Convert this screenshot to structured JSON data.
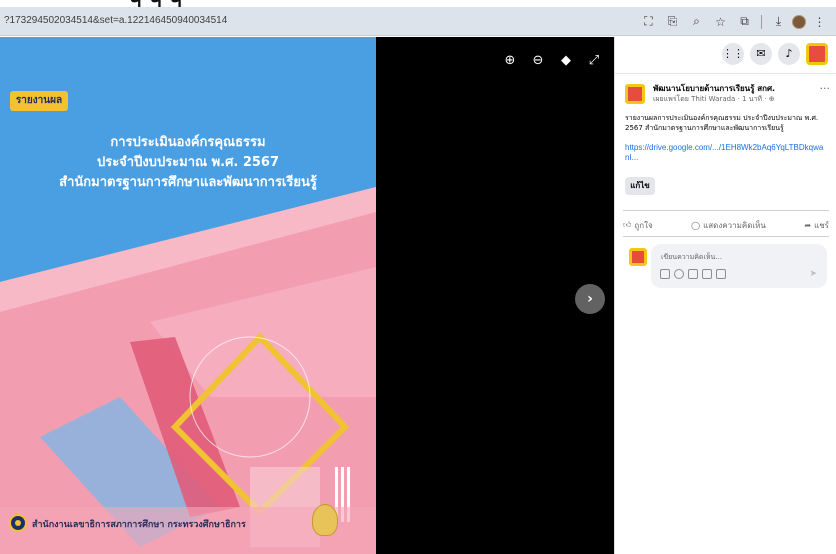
{
  "browser": {
    "url": "?173294502034514&set=a.122146450940034514",
    "icons": [
      "screenshot-icon",
      "translate-icon",
      "zoom-icon",
      "bookmark-star-icon",
      "extensions-icon",
      "download-icon",
      "profile-icon",
      "menu-icon"
    ]
  },
  "poster": {
    "tag": "รายงานผล",
    "title_line1": "การประเมินองค์กรคุณธรรม",
    "title_line2": "ประจำปีงบประมาณ พ.ศ. 2567",
    "title_line3": "สำนักมาตรฐานการศึกษาและพัฒนาการเรียนรู้",
    "footer": "สำนักงานเลขาธิการสภาการศึกษา กระทรวงศึกษาธิการ",
    "colors": {
      "pink": "#f39db0",
      "blue": "#4a9fe3",
      "gold": "#f1c232",
      "navy": "#2c2c5a"
    }
  },
  "viewer": {
    "tools": [
      "zoom-in-icon",
      "zoom-out-icon",
      "tag-icon",
      "fullscreen-icon"
    ],
    "next_glyph": "›"
  },
  "panel": {
    "top_icons": [
      "menu-grid-icon",
      "messenger-icon",
      "notifications-icon",
      "profile-avatar"
    ],
    "post": {
      "author": "พัฒนานโยบายด้านการเรียนรู้ สกศ.",
      "meta": "เผยแพร่โดย Thiti Warada · 1 นาที · ⊕",
      "more": "···",
      "body": "รายงานผลการประเมินองค์กรคุณธรรม ประจำปีงบประมาณ พ.ศ. 2567 สำนักมาตรฐานการศึกษาและพัฒนาการเรียนรู้",
      "link": "https://drive.google.com/.../1EH8Wk2bAq6YqLTBDkqwanI...",
      "edit_label": "แก้ไข"
    },
    "actions": {
      "like": "ถูกใจ",
      "comment": "แสดงความคิดเห็น",
      "share": "แชร์"
    },
    "comment": {
      "placeholder": "เขียนความคิดเห็น..."
    }
  }
}
